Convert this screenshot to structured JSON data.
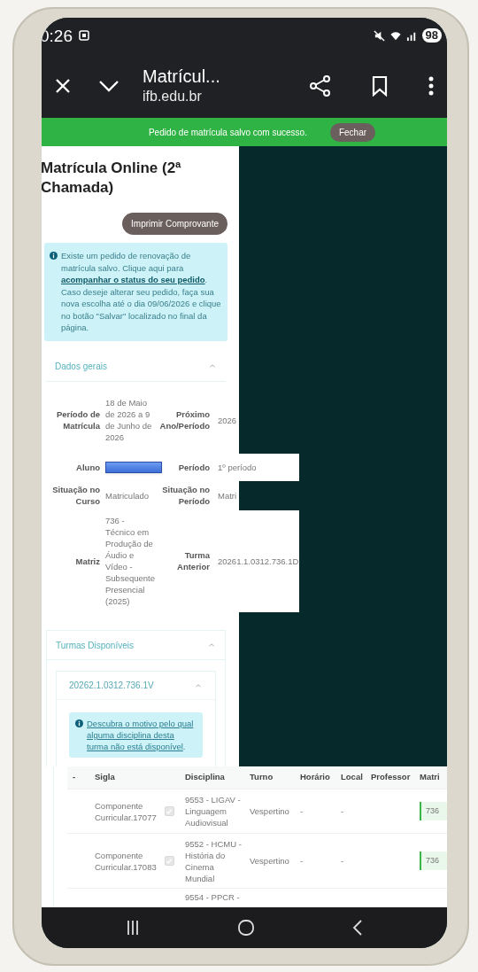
{
  "status_bar": {
    "time": "0:26",
    "battery": "98"
  },
  "toolbar": {
    "title": "Matrícul...",
    "url": "ifb.edu.br"
  },
  "banner": {
    "message": "Pedido de matrícula salvo com sucesso.",
    "button": "Fechar"
  },
  "page": {
    "heading": "Matrícula Online (2ª Chamada)",
    "print_button": "Imprimir Comprovante",
    "info": {
      "before": "Existe um pedido de renovação de matrícula salvo. Clique aqui para ",
      "link": "acompanhar o status do seu pedido",
      "after": ". Caso deseje alterar seu pedido, faça sua nova escolha até o dia 09/06/2026 e clique no botão \"Salvar\" localizado no final da página."
    }
  },
  "general_data": {
    "title": "Dados gerais",
    "expanded": true,
    "rows": [
      {
        "label": "Período de Matrícula",
        "value": "18 de Maio de 2026 a 9 de Junho de 2026",
        "label_2": "Próximo Ano/Período",
        "value_2": "2026"
      },
      {
        "label": "Aluno",
        "redacted": true,
        "label_2": "Período",
        "value_2": "1º período"
      },
      {
        "label": "Situação no Curso",
        "value": "Matriculado",
        "label_2": "Situação no Período",
        "value_2": "Matri"
      },
      {
        "label": "Matriz",
        "value": "736 - Técnico em Produção de Áudio e Vídeo - Subsequente Presencial (2025)",
        "label_2": "Turma Anterior",
        "value_2": "20261.1.0312.736.1D"
      }
    ]
  },
  "classes": {
    "title": "Turmas Disponíveis",
    "expanded": true,
    "group": {
      "title": "20262.1.0312.736.1V",
      "expanded": true,
      "info_link": "Descubra o motivo pelo qual alguma disciplina desta turma não está disponível",
      "info_suffix": "."
    },
    "table": {
      "columns": [
        "-",
        "Sigla",
        "Disciplina",
        "Turno",
        "Horário",
        "Local",
        "Professor",
        "Matri"
      ],
      "rows": [
        {
          "sigla": "Componente Curricular.17077",
          "checked": true,
          "disabled": true,
          "disciplina": "9553 - LIGAV - Linguagem Audiovisual",
          "turno": "Vespertino",
          "horario": "-",
          "local": "-",
          "matriz": "736"
        },
        {
          "sigla": "Componente Curricular.17083",
          "checked": true,
          "disabled": true,
          "disciplina": "9552 - HCMU - História do Cinema Mundial",
          "turno": "Vespertino",
          "horario": "-",
          "local": "-",
          "matriz": "736"
        },
        {
          "disciplina": "9554 - PPCR -"
        }
      ]
    }
  }
}
